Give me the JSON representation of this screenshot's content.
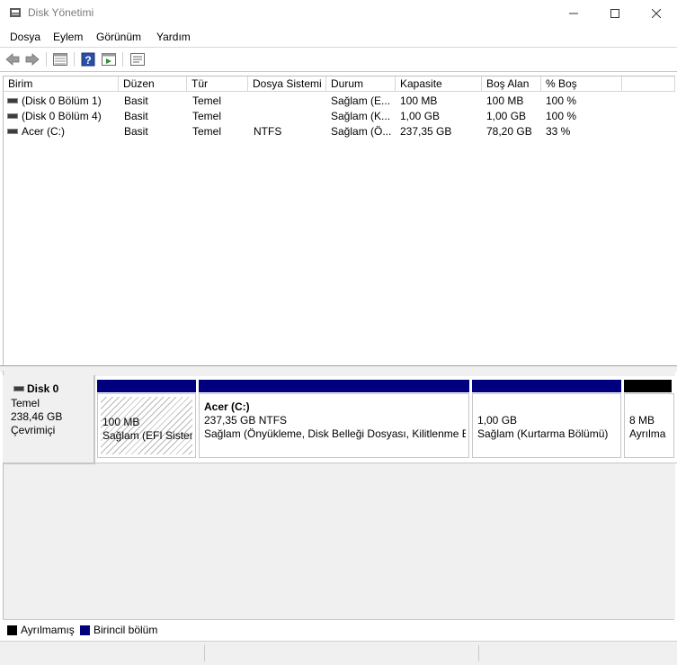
{
  "window": {
    "title": "Disk Yönetimi",
    "icon": "disk-management-icon"
  },
  "menu": [
    "Dosya",
    "Eylem",
    "Görünüm",
    "Yardım"
  ],
  "toolbar": {
    "icons": [
      "back-arrow-icon",
      "forward-arrow-icon",
      "properties-grid-icon",
      "help-icon",
      "refresh-view-icon",
      "settings-list-icon"
    ]
  },
  "table": {
    "headers": [
      "Birim",
      "Düzen",
      "Tür",
      "Dosya Sistemi",
      "Durum",
      "Kapasite",
      "Boş Alan",
      "% Boş"
    ],
    "rows": [
      [
        "(Disk 0 Bölüm 1)",
        "Basit",
        "Temel",
        "",
        "Sağlam (E...",
        "100 MB",
        "100 MB",
        "100 %"
      ],
      [
        "(Disk 0 Bölüm 4)",
        "Basit",
        "Temel",
        "",
        "Sağlam (K...",
        "1,00 GB",
        "1,00 GB",
        "100 %"
      ],
      [
        "Acer (C:)",
        "Basit",
        "Temel",
        "NTFS",
        "Sağlam (Ö...",
        "237,35 GB",
        "78,20 GB",
        "33 %"
      ]
    ]
  },
  "disk": {
    "name": "Disk 0",
    "type": "Temel",
    "size": "238,46 GB",
    "status": "Çevrimiçi"
  },
  "partitions": [
    {
      "title": "",
      "size": "100 MB",
      "status": "Sağlam (EFI Sistem"
    },
    {
      "title": "Acer  (C:)",
      "size": "237,35 GB NTFS",
      "status": "Sağlam (Önyükleme, Disk Belleği Dosyası, Kilitlenme Bi"
    },
    {
      "title": "",
      "size": "1,00 GB",
      "status": "Sağlam (Kurtarma Bölümü)"
    },
    {
      "title": "",
      "size": "8 MB",
      "status": "Ayrılma"
    }
  ],
  "legend": {
    "unallocated": "Ayrılmamış",
    "primary": "Birincil bölüm",
    "colors": {
      "unallocated": "#000000",
      "primary": "#00007f"
    }
  },
  "window_controls": [
    "minimize-icon",
    "maximize-icon",
    "close-icon"
  ]
}
